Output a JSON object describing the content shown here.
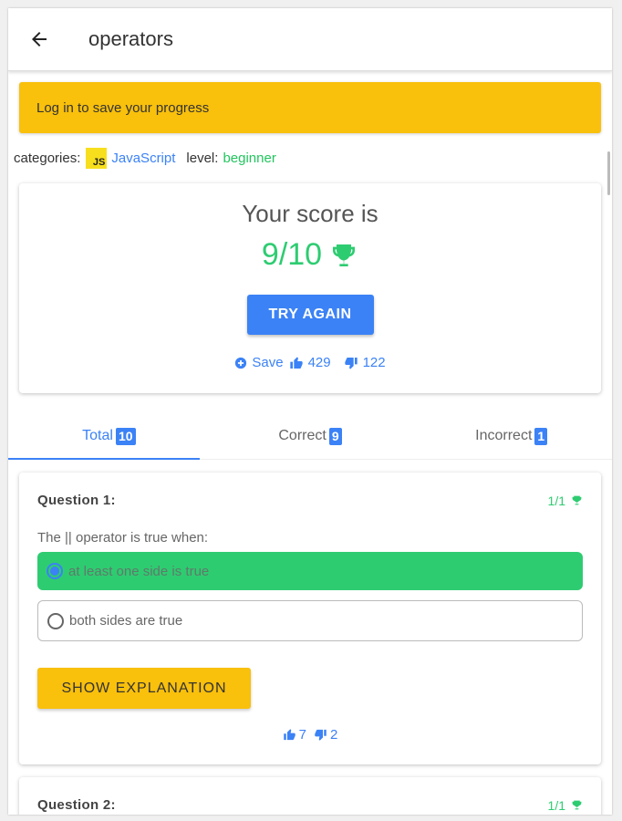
{
  "appbar": {
    "title": "operators"
  },
  "banner": {
    "text": "Log in to save your progress"
  },
  "meta": {
    "categories_label": "categories:",
    "js_badge": "JS",
    "category": "JavaScript",
    "level_label": "level:",
    "level": "beginner"
  },
  "score": {
    "heading": "Your score is",
    "value": "9/10",
    "try_again": "TRY AGAIN",
    "save_label": "Save",
    "likes": "429",
    "dislikes": "122"
  },
  "tabs": [
    {
      "label": "Total",
      "count": "10"
    },
    {
      "label": "Correct",
      "count": "9"
    },
    {
      "label": "Incorrect",
      "count": "1"
    }
  ],
  "questions": [
    {
      "title": "Question 1:",
      "points": "1/1",
      "text": "The || operator is true when:",
      "options": [
        "at least one side is true",
        "both sides are true"
      ],
      "explain_label": "SHOW EXPLANATION",
      "likes": "7",
      "dislikes": "2"
    },
    {
      "title": "Question 2:",
      "points": "1/1"
    }
  ],
  "colors": {
    "primary": "#3b82f6",
    "success": "#2ecc71",
    "warning": "#f9c00c",
    "js_yellow": "#f7df1e"
  },
  "icons": [
    "back-arrow-icon",
    "trophy-icon",
    "plus-circle-icon",
    "thumbs-up-icon",
    "thumbs-down-icon"
  ]
}
